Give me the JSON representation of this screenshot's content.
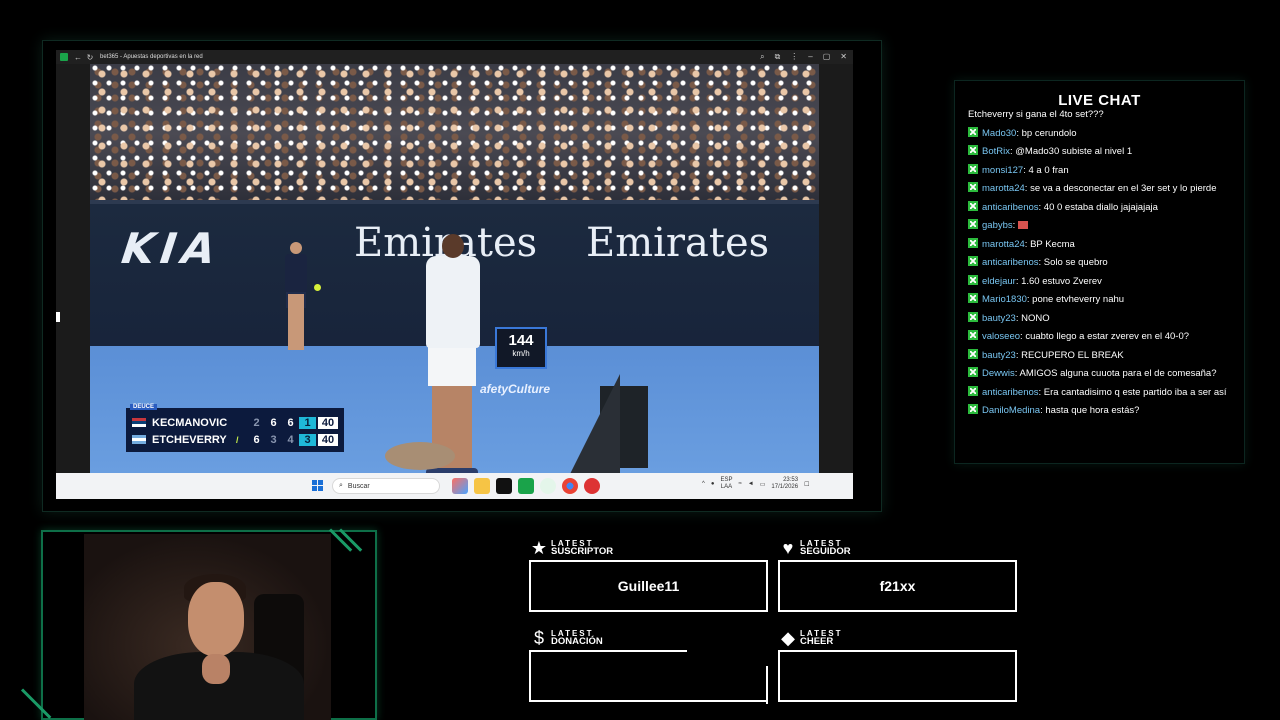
{
  "browser": {
    "title": "bet365 - Apuestas deportivas en la red",
    "icons": [
      "app-icon",
      "back-icon",
      "reload-icon",
      "zoom-icon",
      "extensions-icon",
      "menu-icon",
      "minimize-icon",
      "restore-icon",
      "close-icon"
    ]
  },
  "broadcast": {
    "sponsor_left": "KIA",
    "sponsor_main": "Emirates",
    "speed_value": "144",
    "speed_unit": "km/h",
    "safety_text": "afetyCulture",
    "score": {
      "tag": "DEUCE",
      "players": [
        {
          "name": "KECMANOVIC",
          "sets": [
            "2",
            "6"
          ],
          "current_set": "6",
          "current_games": "1",
          "points": "40",
          "serving": false
        },
        {
          "name": "ETCHEVERRY",
          "sets": [
            "6",
            "3"
          ],
          "current_set": "4",
          "current_games": "3",
          "points": "40",
          "serving": true
        }
      ]
    }
  },
  "taskbar": {
    "search_placeholder": "Buscar",
    "lang_1": "ESP",
    "lang_2": "LAA",
    "time": "23:53",
    "date": "17/1/2026"
  },
  "chat": {
    "title": "LIVE CHAT",
    "partial_top": "Etcheverry si gana el 4to set???",
    "messages": [
      {
        "user": "Mado30",
        "text": "bp cerundolo"
      },
      {
        "user": "BotRix",
        "text": "@Mado30 subiste al nivel 1"
      },
      {
        "user": "monsi127",
        "text": "4 a 0 fran"
      },
      {
        "user": "marotta24",
        "text": "se va a desconectar en el 3er set y lo pierde"
      },
      {
        "user": "anticaribenos",
        "text": "40 0 estaba diallo jajajajaja"
      },
      {
        "user": "gabybs",
        "text": ""
      },
      {
        "user": "marotta24",
        "text": "BP Kecma"
      },
      {
        "user": "anticaribenos",
        "text": "Solo se quebro"
      },
      {
        "user": "eldejaur",
        "text": "1.60 estuvo Zverev"
      },
      {
        "user": "Mario1830",
        "text": "pone etvheverry nahu"
      },
      {
        "user": "bauty23",
        "text": "NONO"
      },
      {
        "user": "valoseeo",
        "text": "cuabto llego a estar zverev en el 40-0?"
      },
      {
        "user": "bauty23",
        "text": "RECUPERO EL BREAK"
      },
      {
        "user": "Dewwis",
        "text": "AMIGOS alguna cuuota para el de comesaña?"
      },
      {
        "user": "anticaribenos",
        "text": "Era cantadisimo q este partido iba a ser así"
      },
      {
        "user": "DaniloMedina",
        "text": "hasta que hora estás?"
      }
    ]
  },
  "stats": {
    "suscriptor": {
      "l1": "LATEST",
      "l2": "SUSCRIPTOR",
      "value": "Guillee11",
      "icon": "star-icon"
    },
    "seguidor": {
      "l1": "LATEST",
      "l2": "SEGUIDOR",
      "value": "f21xx",
      "icon": "heart-icon"
    },
    "donacion": {
      "l1": "LATEST",
      "l2": "DONACIÓN",
      "value": "",
      "icon": "dollar-icon"
    },
    "cheer": {
      "l1": "LATEST",
      "l2": "CHEER",
      "value": "",
      "icon": "diamond-icon"
    }
  }
}
